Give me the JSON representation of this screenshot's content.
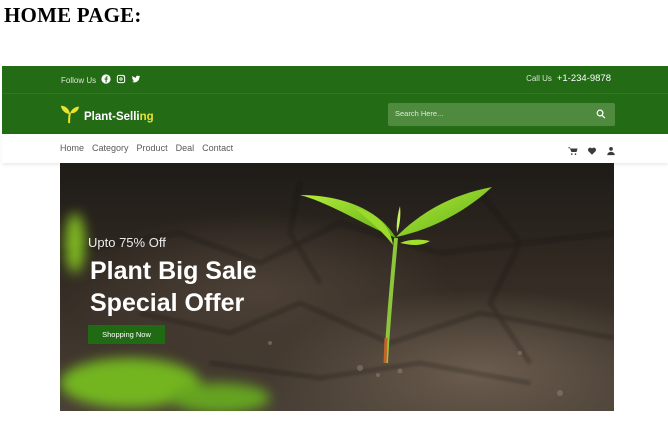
{
  "document": {
    "heading": "HOME PAGE:"
  },
  "topbar": {
    "follow_label": "Follow Us",
    "social_icons": [
      "facebook-icon",
      "instagram-icon",
      "twitter-icon"
    ],
    "call_label": "Call Us",
    "phone": "+1-234-9878"
  },
  "brand": {
    "name_part1": "Plant",
    "name_part2": "-Selli",
    "name_part3": "ng"
  },
  "search": {
    "placeholder": "Search Here..."
  },
  "nav": {
    "items": [
      "Home",
      "Category",
      "Product",
      "Deal",
      "Contact"
    ],
    "icons": [
      "cart-icon",
      "heart-icon",
      "user-icon"
    ]
  },
  "hero": {
    "subtitle": "Upto 75% Off",
    "title_line1": "Plant Big Sale",
    "title_line2": "Special Offer",
    "button": "Shopping Now"
  },
  "colors": {
    "primary_green": "#246b16",
    "search_green": "#4f8a3f",
    "logo_yellow": "#e8e231"
  }
}
